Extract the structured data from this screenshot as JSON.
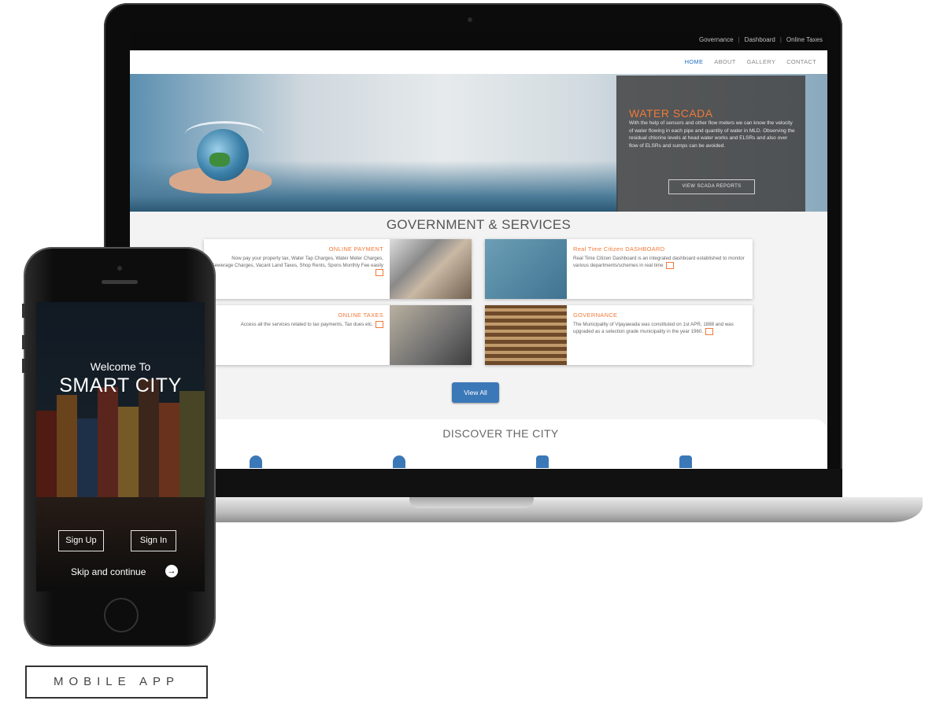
{
  "laptop_site": {
    "top_links": [
      "Governance",
      "Dashboard",
      "Online Taxes"
    ],
    "nav": [
      "HOME",
      "ABOUT",
      "GALLERY",
      "CONTACT"
    ],
    "active_nav": "HOME",
    "hero": {
      "title": "WATER SCADA",
      "text": "With the help of sensors and other flow meters we can know the velocity of water flowing in each pipe and quantity of water in MLD. Observing the residual chlorine levels at head water works and ELSRs and also over flow of ELSRs and sumps can be avoided.",
      "button": "VIEW SCADA REPORTS"
    },
    "section_title": "GOVERNMENT & SERVICES",
    "cards": [
      {
        "title": "ONLINE PAYMENT",
        "text": "Now pay your property tax, Water Tap Charges, Water Meter Charges, Sewerage Charges, Vacant Land Taxes, Shop Rents, Spons Monthly Fee easily"
      },
      {
        "title": "Real Time Citizen DASHBOARD",
        "text": "Real Time Citizen Dashboard is an integrated dashboard established to monitor various departments/schemes in real time"
      },
      {
        "title": "ONLINE TAXES",
        "text": "Access all the services related to tax payments, Tax dues etc."
      },
      {
        "title": "GOVERNANCE",
        "text": "The Municipality of Vijayawada was constituted on 1st APR, 1888 and was upgraded as a selection grade municipality in the year 1960."
      }
    ],
    "view_all": "View All",
    "discover_title": "DISCOVER THE CITY"
  },
  "phone_app": {
    "welcome": "Welcome To",
    "title": "SMART CITY",
    "sign_up": "Sign Up",
    "sign_in": "Sign In",
    "skip": "Skip and continue"
  },
  "caption": "MOBILE APP",
  "colors": {
    "accent": "#ef7a3a",
    "primary": "#3b78b8"
  }
}
